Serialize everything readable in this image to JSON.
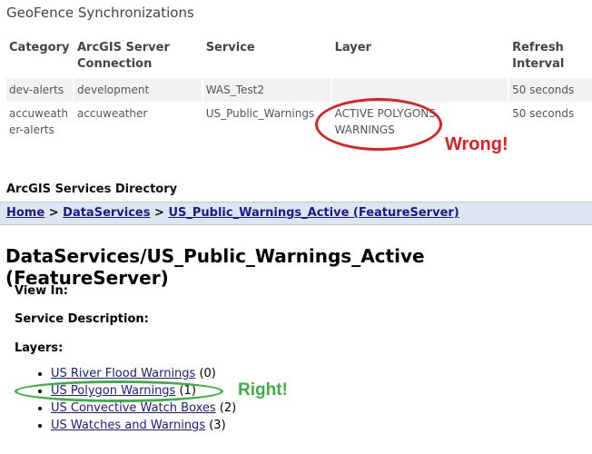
{
  "geofence": {
    "title": "GeoFence Synchronizations",
    "headers": [
      "Category",
      "ArcGIS Server Connection",
      "Service",
      "Layer",
      "Refresh Interval"
    ],
    "rows": [
      [
        "dev-alerts",
        "development",
        "WAS_Test2",
        "",
        "50 seconds"
      ],
      [
        "accuweather-alerts",
        "accuweather",
        "US_Public_Warnings",
        "ACTIVE POLYGONS WARNINGS",
        "50 seconds"
      ]
    ]
  },
  "annotations": {
    "wrong": "Wrong!",
    "right": "Right!",
    "wrong_color": "#e02020",
    "right_color": "#3cb043"
  },
  "directory": {
    "title": "ArcGIS Services Directory",
    "breadcrumb": [
      "Home",
      "DataServices",
      "US_Public_Warnings_Active (FeatureServer)"
    ],
    "separator": ">",
    "heading": "DataServices/US_Public_Warnings_Active (FeatureServer)",
    "view_in": "View In:",
    "service_description": "Service Description:",
    "layers_label": "Layers:",
    "layers": [
      {
        "name": "US River Flood Warnings",
        "id": "(0)"
      },
      {
        "name": "US Polygon Warnings",
        "id": "(1)"
      },
      {
        "name": "US Convective Watch Boxes",
        "id": "(2)"
      },
      {
        "name": "US Watches and Warnings",
        "id": "(3)"
      }
    ]
  }
}
